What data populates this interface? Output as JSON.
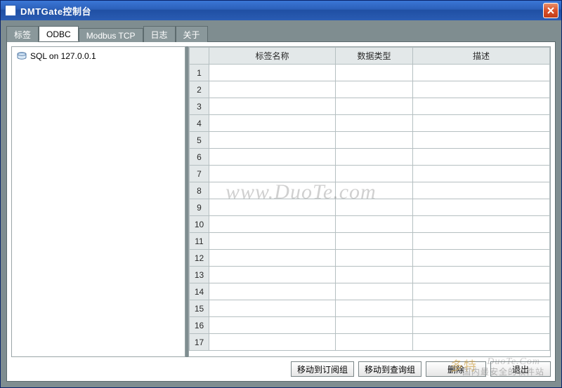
{
  "window": {
    "title": "DMTGate控制台"
  },
  "tabs": [
    {
      "id": "tags",
      "label": "标签",
      "active": false
    },
    {
      "id": "odbc",
      "label": "ODBC",
      "active": true
    },
    {
      "id": "modbus",
      "label": "Modbus TCP",
      "active": false
    },
    {
      "id": "log",
      "label": "日志",
      "active": false
    },
    {
      "id": "about",
      "label": "关于",
      "active": false
    }
  ],
  "tree": {
    "items": [
      {
        "icon": "database-icon",
        "label": "SQL on 127.0.0.1"
      }
    ]
  },
  "grid": {
    "columns": {
      "name": "标签名称",
      "type": "数据类型",
      "desc": "描述"
    },
    "row_count": 17
  },
  "buttons": {
    "move_sub": "移动到订阅组",
    "move_query": "移动到查询组",
    "delete": "删除",
    "exit": "退出"
  },
  "watermark": {
    "main": "www.DuoTe.com",
    "logo": "多特",
    "en": "DuoTe.Com",
    "cn": "国内最安全的软件站"
  }
}
